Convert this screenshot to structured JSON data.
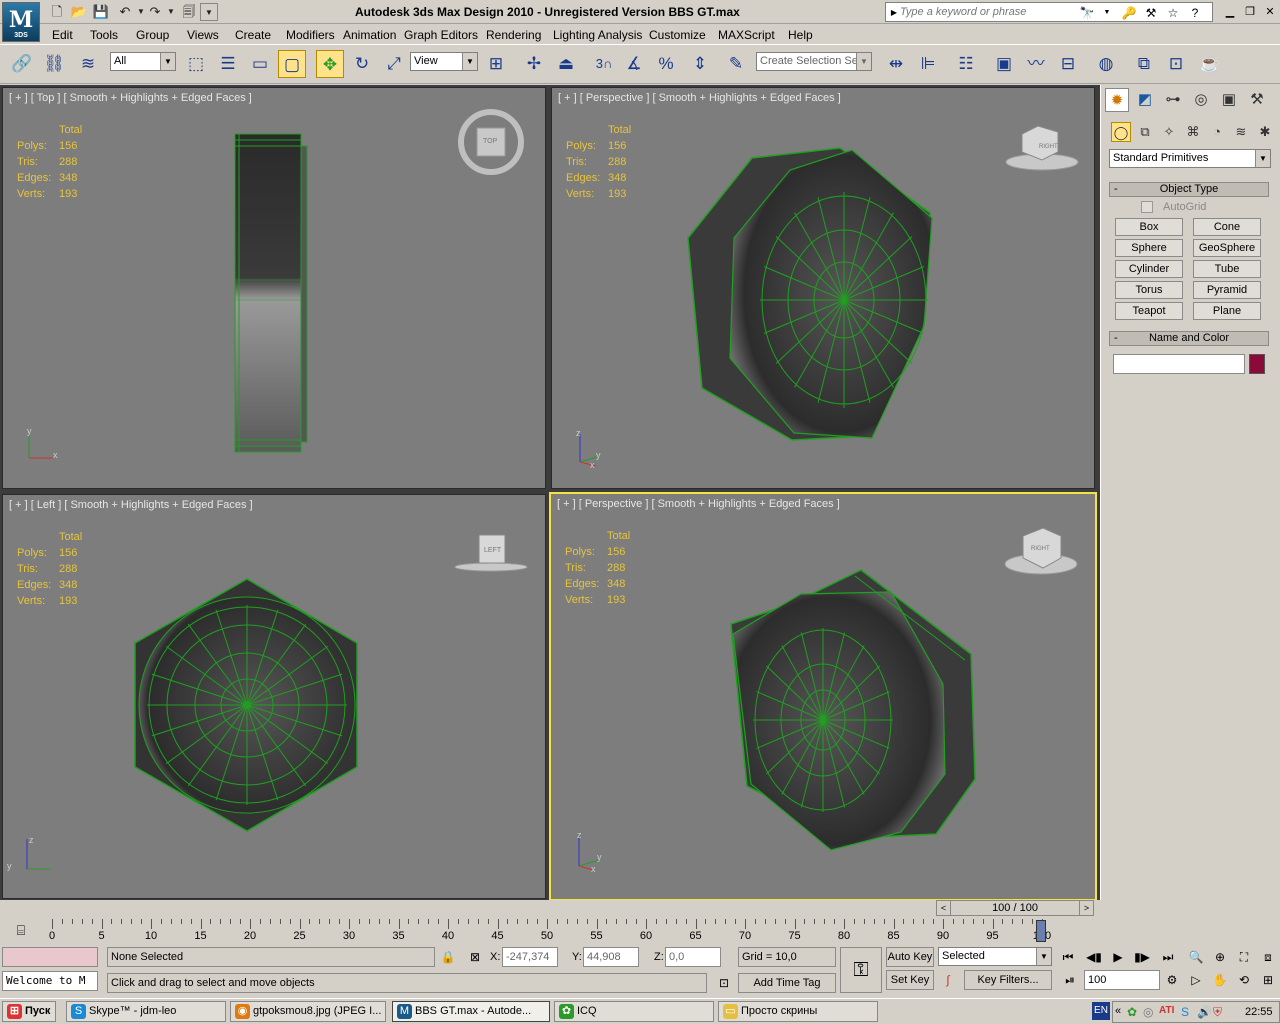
{
  "window": {
    "logo_text": "M",
    "logo_caption": "3DS",
    "title": "Autodesk 3ds Max Design 2010  - Unregistered Version    BBS GT.max",
    "search_placeholder": "Type a keyword or phrase"
  },
  "menu": [
    "Edit",
    "Tools",
    "Group",
    "Views",
    "Create",
    "Modifiers",
    "Animation",
    "Graph Editors",
    "Rendering",
    "Lighting Analysis",
    "Customize",
    "MAXScript",
    "Help"
  ],
  "toolbar": {
    "selection_filter": "All",
    "ref_coord": "View",
    "snap_label": "3",
    "named_selection_placeholder": "Create Selection Se"
  },
  "viewports": [
    {
      "label": "[ + ] [ Top ] [ Smooth + Highlights + Edged Faces ]",
      "cube_label": "TOP",
      "axis": [
        "y",
        "x"
      ]
    },
    {
      "label": "[ + ] [ Perspective ] [ Smooth + Highlights + Edged Faces ]",
      "cube_label": "RIGHT",
      "axis": [
        "z",
        "y",
        "x"
      ]
    },
    {
      "label": "[ + ] [ Left ] [ Smooth + Highlights + Edged Faces ]",
      "cube_label": "LEFT",
      "axis": [
        "z",
        "y"
      ]
    },
    {
      "label": "[ + ] [ Perspective ] [ Smooth + Highlights + Edged Faces ]",
      "cube_label": "RIGHT",
      "axis": [
        "z",
        "y",
        "x"
      ]
    }
  ],
  "stats": {
    "header": "Total",
    "rows": [
      {
        "key": "Polys:",
        "value": "156"
      },
      {
        "key": "Tris:",
        "value": "288"
      },
      {
        "key": "Edges:",
        "value": "348"
      },
      {
        "key": "Verts:",
        "value": "193"
      }
    ]
  },
  "command_panel": {
    "category": "Standard Primitives",
    "object_type_title": "Object Type",
    "autogrid": "AutoGrid",
    "buttons": [
      "Box",
      "Cone",
      "Sphere",
      "GeoSphere",
      "Cylinder",
      "Tube",
      "Torus",
      "Pyramid",
      "Teapot",
      "Plane"
    ],
    "name_color_title": "Name and Color",
    "object_name": "",
    "object_color": "#8a0a3a"
  },
  "timeline": {
    "frame_display": "100 / 100",
    "ticks": [
      "0",
      "5",
      "10",
      "15",
      "20",
      "25",
      "30",
      "35",
      "40",
      "45",
      "50",
      "55",
      "60",
      "65",
      "70",
      "75",
      "80",
      "85",
      "90",
      "95",
      "100"
    ]
  },
  "status": {
    "maxscript_listener": "Welcome to M",
    "selection": "None Selected",
    "prompt": "Click and drag to select and move objects",
    "x_label": "X:",
    "x_value": "-247,374",
    "y_label": "Y:",
    "y_value": "44,908",
    "z_label": "Z:",
    "z_value": "0,0",
    "grid": "Grid = 10,0",
    "add_time_tag": "Add Time Tag",
    "auto_key": "Auto Key",
    "set_key": "Set Key",
    "key_mode": "Selected",
    "key_filters": "Key Filters...",
    "current_frame": "100"
  },
  "taskbar": {
    "start": "Пуск",
    "tasks": [
      "Skype™ - jdm-leo",
      "gtpoksmou8.jpg (JPEG I...",
      "BBS GT.max - Autode...",
      "ICQ",
      "Просто скрины"
    ],
    "lang": "EN",
    "clock": "22:55"
  }
}
